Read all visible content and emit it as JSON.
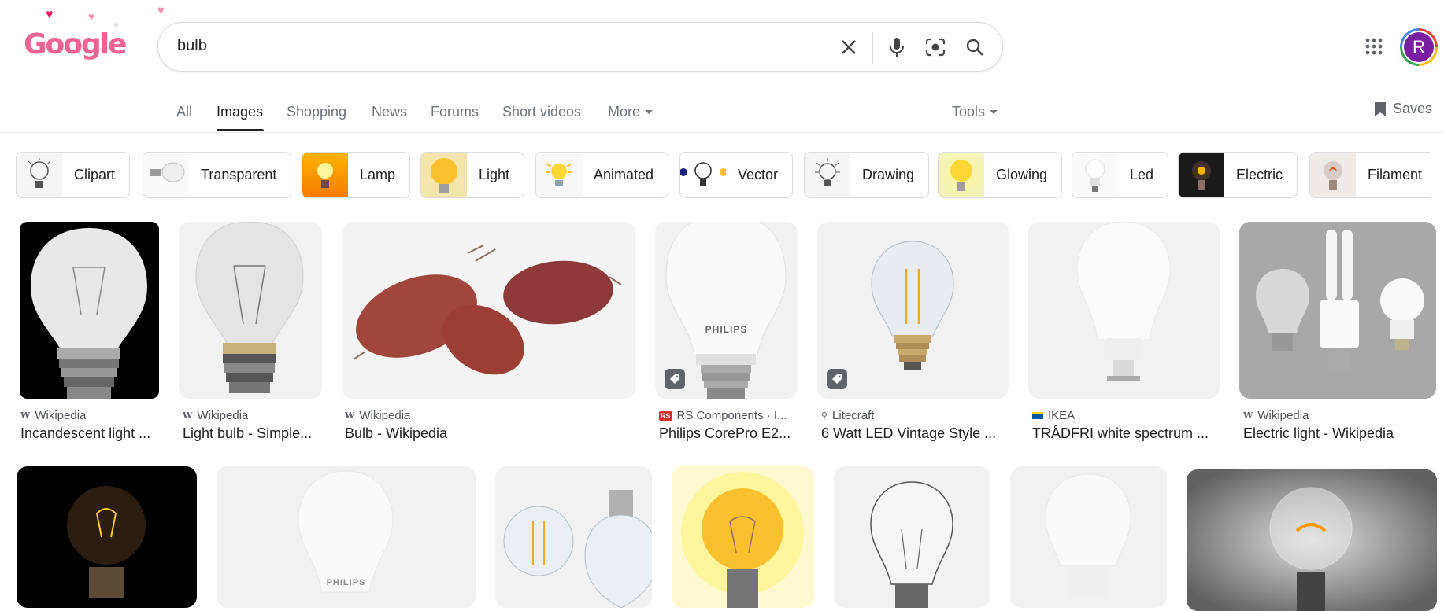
{
  "search": {
    "query": "bulb"
  },
  "header": {
    "logo_text": "Google",
    "avatar_letter": "R"
  },
  "tabs": [
    {
      "label": "All"
    },
    {
      "label": "Images"
    },
    {
      "label": "Shopping"
    },
    {
      "label": "News"
    },
    {
      "label": "Forums"
    },
    {
      "label": "Short videos"
    },
    {
      "label": "More"
    }
  ],
  "tools_label": "Tools",
  "saves_label": "Saves",
  "chips": [
    {
      "label": "Clipart"
    },
    {
      "label": "Transparent"
    },
    {
      "label": "Lamp"
    },
    {
      "label": "Light"
    },
    {
      "label": "Animated"
    },
    {
      "label": "Vector"
    },
    {
      "label": "Drawing"
    },
    {
      "label": "Glowing"
    },
    {
      "label": "Led"
    },
    {
      "label": "Electric"
    },
    {
      "label": "Filament"
    }
  ],
  "results": [
    {
      "source": "Wikipedia",
      "title": "Incandescent light ..."
    },
    {
      "source": "Wikipedia",
      "title": "Light bulb - Simple..."
    },
    {
      "source": "Wikipedia",
      "title": "Bulb - Wikipedia"
    },
    {
      "source": "RS Components · I...",
      "title": "Philips CorePro E2...",
      "brand": "PHILIPS"
    },
    {
      "source": "Litecraft",
      "title": "6 Watt LED Vintage Style ..."
    },
    {
      "source": "IKEA",
      "title": "TRÅDFRI white spectrum ..."
    },
    {
      "source": "Wikipedia",
      "title": "Electric light - Wikipedia"
    }
  ],
  "second_row_brand": "PHILIPS",
  "colors": {
    "accent_dark": "#202124",
    "muted": "#70757a",
    "logo_pink": "#f06292",
    "avatar": "#7b1fa2"
  }
}
